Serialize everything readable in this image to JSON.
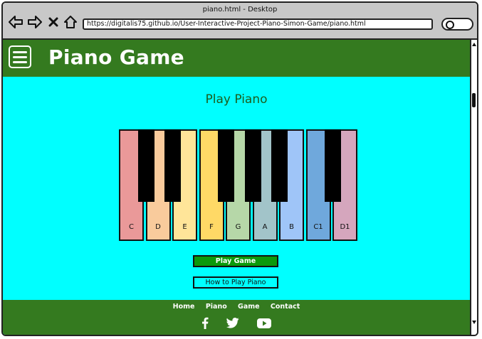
{
  "window": {
    "title": "piano.html - Desktop"
  },
  "browser": {
    "url": "https://digitalis75.github.io/User-Interactive-Project-Piano-Simon-Game/piano.html",
    "back_icon": "back-arrow-icon",
    "forward_icon": "forward-arrow-icon",
    "close_icon": "close-icon",
    "home_icon": "home-icon",
    "search_icon": "search-icon"
  },
  "header": {
    "brand": "Piano Game",
    "menu_icon": "hamburger-menu-icon"
  },
  "main": {
    "heading": "Play Piano",
    "white_keys": [
      {
        "label": "C",
        "color": "#ea9999"
      },
      {
        "label": "D",
        "color": "#f9cb9c"
      },
      {
        "label": "E",
        "color": "#ffe599"
      },
      {
        "label": "F",
        "color": "#ffd966"
      },
      {
        "label": "G",
        "color": "#b6d7a8"
      },
      {
        "label": "A",
        "color": "#a2c4c9"
      },
      {
        "label": "B",
        "color": "#9fc5f8"
      },
      {
        "label": "C1",
        "color": "#6fa8dc"
      },
      {
        "label": "D1",
        "color": "#d5a6bd"
      }
    ],
    "buttons": {
      "play_game": "Play Game",
      "how_to": "How to Play Piano"
    }
  },
  "footer": {
    "links": [
      "Home",
      "Piano",
      "Game",
      "Contact"
    ],
    "social": [
      "facebook-icon",
      "twitter-icon",
      "youtube-icon"
    ]
  },
  "colors": {
    "header_bg": "#347a1f",
    "page_bg": "#00ffff",
    "button_green": "#0b9a0b"
  }
}
